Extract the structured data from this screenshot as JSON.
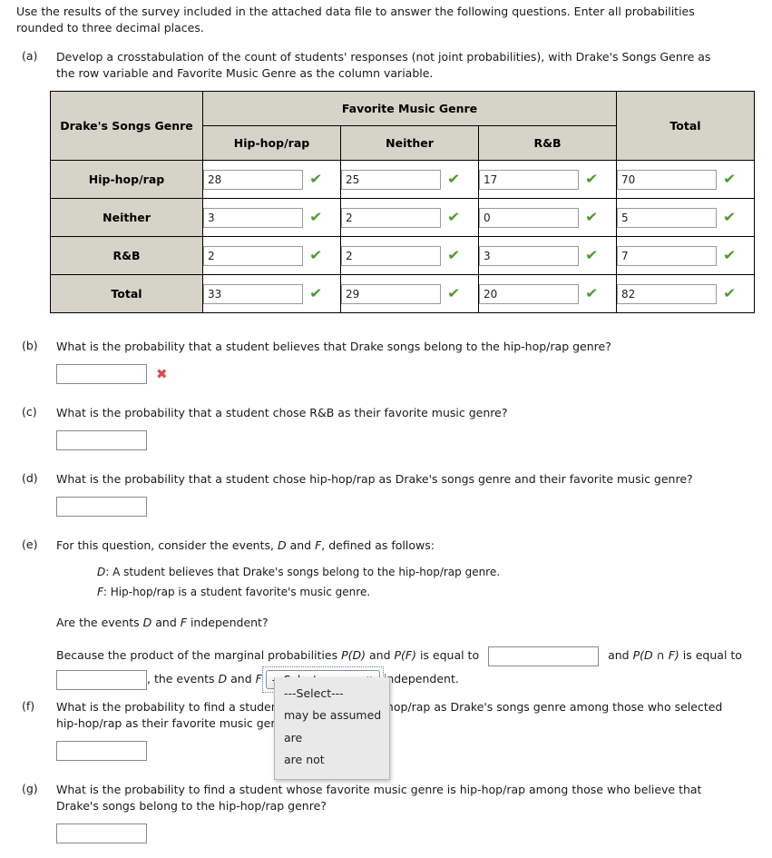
{
  "intro": {
    "line1": "Use the results of the survey included in the attached data file to answer the following questions. Enter all probabilities",
    "line2": "rounded to three decimal places."
  },
  "questions": {
    "a": {
      "label": "(a)",
      "line1": "Develop a crosstabulation of the count of students' responses (not joint probabilities), with Drake's Songs Genre as",
      "line2": "the row variable and Favorite Music Genre as the column variable."
    },
    "b": {
      "label": "(b)",
      "text": "What is the probability that a student believes that Drake songs belong to the hip-hop/rap genre?",
      "answer": "",
      "status": "incorrect",
      "status_glyph": "✖"
    },
    "c": {
      "label": "(c)",
      "text": "What is the probability that a student chose R&B as their favorite music genre?",
      "answer": ""
    },
    "d": {
      "label": "(d)",
      "text": "What is the probability that a student chose hip-hop/rap as Drake's songs genre and their favorite music genre?",
      "answer": ""
    },
    "e": {
      "label": "(e)",
      "intro_pre": "For this question, consider the events, ",
      "var_d": "D",
      "intro_mid": " and ",
      "var_f": "F",
      "intro_post": ", defined as follows:",
      "def_d_var": "D",
      "def_d_text": ": A student believes that Drake's songs belong to the hip-hop/rap genre.",
      "def_f_var": "F",
      "def_f_text": ": Hip-hop/rap is a student favorite's music genre.",
      "ask_pre": "Are the events ",
      "ask_d": "D",
      "ask_mid": " and ",
      "ask_f": "F",
      "ask_post": " independent?",
      "because_pre": "Because the product of the marginal probabilities ",
      "pd": "P(D)",
      "because_and": " and ",
      "pf": "P(F)",
      "because_eq": " is equal to",
      "and_label": "and",
      "pdf": "P(D ∩ F)",
      "is_equal_to": "is equal to",
      "comma_events": ", the events ",
      "ev_d": "D",
      "ev_and": " and ",
      "ev_f": "F",
      "independent_word": "independent.",
      "answer1": "",
      "answer2": ""
    },
    "f": {
      "label": "(f)",
      "line1": "What is the probability to find a student who selected hip-hop/rap as Drake's songs genre among those who selected",
      "line2": "hip-hop/rap as their favorite music genre?",
      "answer": ""
    },
    "g": {
      "label": "(g)",
      "line1": "What is the probability to find a student whose favorite music genre is hip-hop/rap among those who believe that",
      "line2": "Drake's songs belong to the hip-hop/rap genre?",
      "answer": ""
    }
  },
  "table": {
    "corner_label": "Drake's Songs Genre",
    "group_header": "Favorite Music Genre",
    "col_headers": [
      "Hip-hop/rap",
      "Neither",
      "R&B"
    ],
    "total_header": "Total",
    "rows": [
      {
        "label": "Hip-hop/rap",
        "values": [
          "28",
          "25",
          "17"
        ],
        "total": "70",
        "marks": [
          "✔",
          "✔",
          "✔"
        ],
        "total_mark": "✔"
      },
      {
        "label": "Neither",
        "values": [
          "3",
          "2",
          "0"
        ],
        "total": "5",
        "marks": [
          "✔",
          "✔",
          "✔"
        ],
        "total_mark": "✔"
      },
      {
        "label": "R&B",
        "values": [
          "2",
          "2",
          "3"
        ],
        "total": "7",
        "marks": [
          "✔",
          "✔",
          "✔"
        ],
        "total_mark": "✔"
      },
      {
        "label": "Total",
        "values": [
          "33",
          "29",
          "20"
        ],
        "total": "82",
        "marks": [
          "✔",
          "✔",
          "✔"
        ],
        "total_mark": "✔"
      }
    ]
  },
  "select": {
    "value": "---Select---",
    "chevron": "∨",
    "options": [
      "---Select---",
      "may be assumed",
      "are",
      "are not"
    ]
  },
  "colors": {
    "header_bg": "#d6d3c8",
    "tick_green": "#4c9a2a",
    "cross_red": "#e0484c",
    "focus_blue": "#4a7ebb"
  }
}
